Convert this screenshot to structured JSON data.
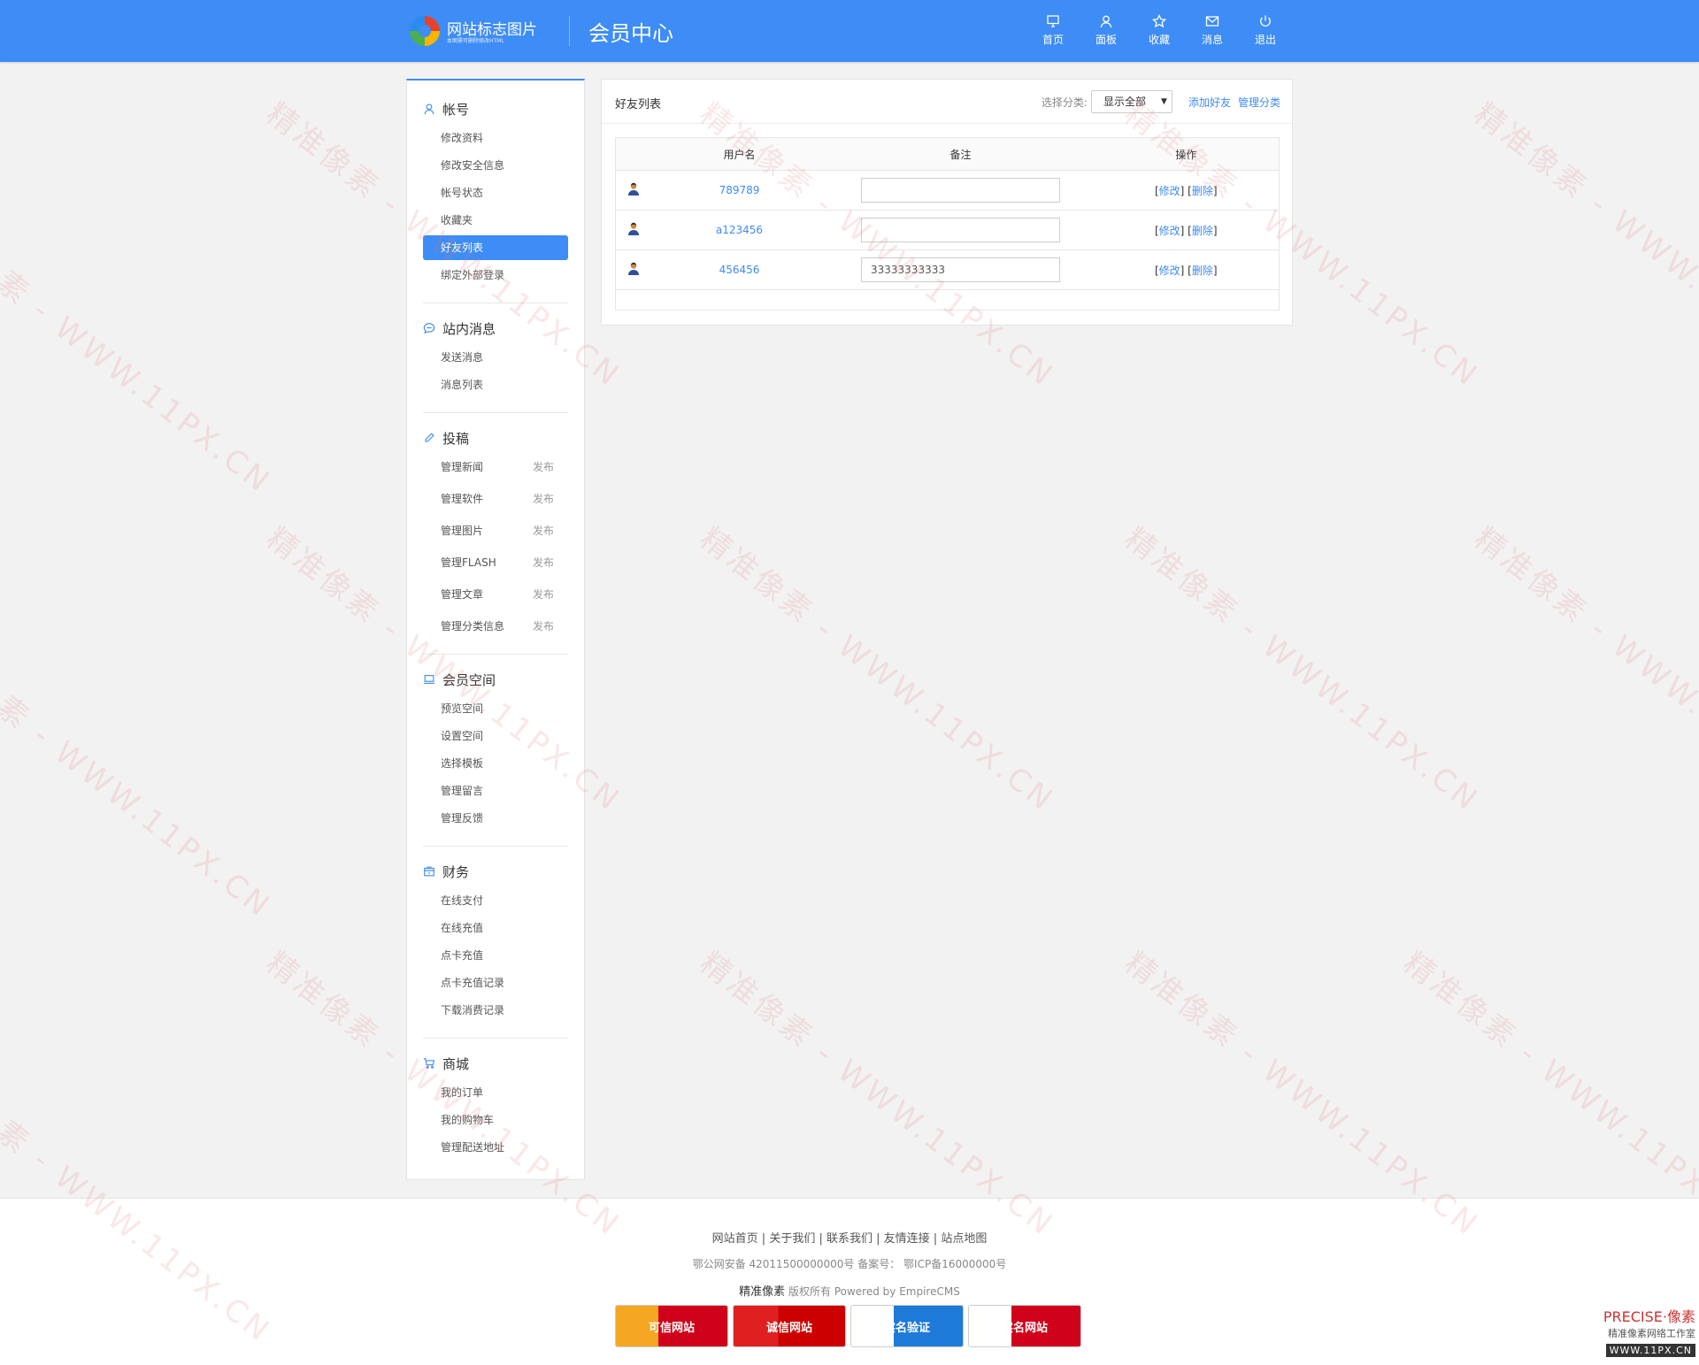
{
  "header": {
    "logo_title": "网站标志图片",
    "logo_sub": "本图需可删除修改HTML",
    "title": "会员中心",
    "nav": [
      {
        "label": "首页",
        "icon": "monitor-icon"
      },
      {
        "label": "面板",
        "icon": "user-icon"
      },
      {
        "label": "收藏",
        "icon": "star-icon"
      },
      {
        "label": "消息",
        "icon": "mail-icon"
      },
      {
        "label": "退出",
        "icon": "power-icon"
      }
    ]
  },
  "sidebar": {
    "account": {
      "heading": "帐号",
      "links": [
        "修改资料",
        "修改安全信息",
        "帐号状态",
        "收藏夹",
        "好友列表",
        "绑定外部登录"
      ],
      "active": "好友列表"
    },
    "messages": {
      "heading": "站内消息",
      "links": [
        "发送消息",
        "消息列表"
      ]
    },
    "submit": {
      "heading": "投稿",
      "publish_label": "发布",
      "links": [
        "管理新闻",
        "管理软件",
        "管理图片",
        "管理FLASH",
        "管理文章",
        "管理分类信息"
      ]
    },
    "space": {
      "heading": "会员空间",
      "links": [
        "预览空间",
        "设置空间",
        "选择模板",
        "管理留言",
        "管理反馈"
      ]
    },
    "finance": {
      "heading": "财务",
      "links": [
        "在线支付",
        "在线充值",
        "点卡充值",
        "点卡充值记录",
        "下载消费记录"
      ]
    },
    "shop": {
      "heading": "商城",
      "links": [
        "我的订单",
        "我的购物车",
        "管理配送地址"
      ]
    }
  },
  "main": {
    "title": "好友列表",
    "category_label": "选择分类:",
    "category_value": "显示全部",
    "add_friend": "添加好友",
    "manage_category": "管理分类",
    "columns": [
      "用户名",
      "备注",
      "操作"
    ],
    "rows": [
      {
        "username": "789789",
        "remark": ""
      },
      {
        "username": "a123456",
        "remark": ""
      },
      {
        "username": "456456",
        "remark": "33333333333"
      }
    ],
    "edit_label": "修改",
    "delete_label": "删除"
  },
  "footer": {
    "links": [
      "网站首页",
      "关于我们",
      "联系我们",
      "友情连接",
      "站点地图"
    ],
    "beian": "鄂公网安备 42011500000000号 备案号： 鄂ICP备16000000号",
    "brand": "精准像素",
    "copyright": "版权所有 Powered by EmpireCMS",
    "badges": [
      "可信网站",
      "诚信网站",
      "实名验证",
      "实名网站"
    ]
  },
  "watermark": "精准像素 - WWW.11PX.CN",
  "corner": {
    "line1": "PRECISE·像素",
    "line2": "精准像素网络工作室",
    "line3": "WWW.11PX.CN"
  },
  "colors": {
    "accent": "#3e8cf5",
    "background": "#f2f2f2"
  }
}
